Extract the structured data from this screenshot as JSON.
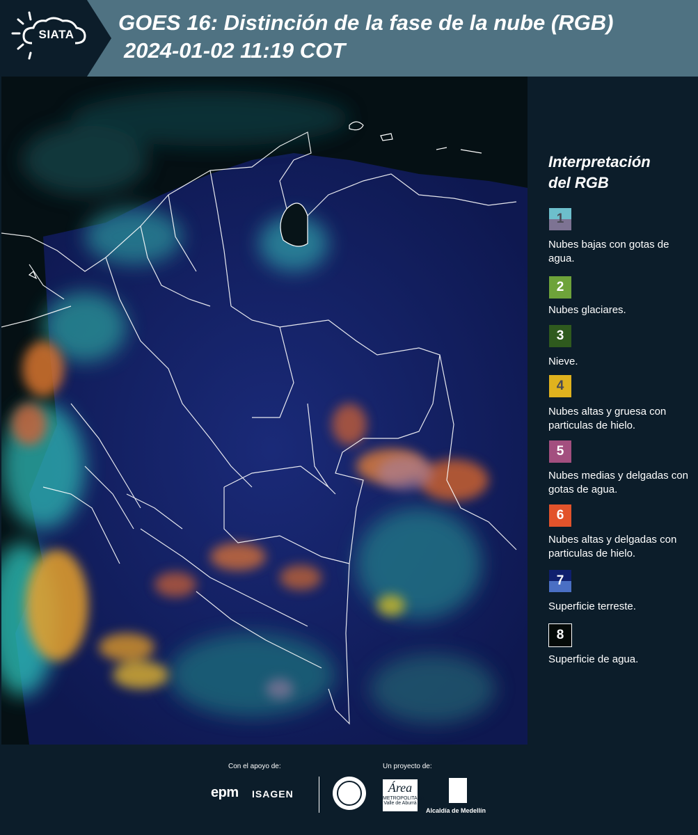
{
  "header": {
    "logo_text": "SIATA",
    "title": "GOES 16: Distinción de la fase de la nube (RGB)",
    "subtitle": "2024-01-02 11:19 COT"
  },
  "legend": {
    "title_line1": "Interpretación",
    "title_line2": "del RGB",
    "items": [
      {
        "num": "1",
        "label": "Nubes bajas con gotas de agua.",
        "color_top": "#6dbfcc",
        "color_bottom": "#7d7393",
        "num_color": "#4a4a55"
      },
      {
        "num": "2",
        "label": "Nubes glaciares.",
        "color_top": "#6ea33a",
        "color_bottom": "#6ea33a",
        "num_color": "#ffffff"
      },
      {
        "num": "3",
        "label": "Nieve.",
        "color_top": "#2f5a1e",
        "color_bottom": "#2f5a1e",
        "num_color": "#ffffff"
      },
      {
        "num": "4",
        "label": "Nubes altas y gruesa con particulas de hielo.",
        "color_top": "#e0b21e",
        "color_bottom": "#e0b21e",
        "num_color": "#4a4a55"
      },
      {
        "num": "5",
        "label": "Nubes medias y delgadas con gotas de agua.",
        "color_top": "#a34f7f",
        "color_bottom": "#a34f7f",
        "num_color": "#ffffff"
      },
      {
        "num": "6",
        "label": "Nubes altas y delgadas con particulas de hielo.",
        "color_top": "#e2532b",
        "color_bottom": "#e2532b",
        "num_color": "#ffffff"
      },
      {
        "num": "7",
        "label": "Superficie terreste.",
        "color_top": "#0f1f6e",
        "color_bottom": "#4a6fc4",
        "num_color": "#ffffff"
      },
      {
        "num": "8",
        "label": "Superficie de agua.",
        "color_top": "#050a08",
        "color_bottom": "#050a08",
        "num_color": "#ffffff"
      }
    ]
  },
  "footer": {
    "support_label": "Con el apoyo de:",
    "project_label": "Un proyecto de:",
    "epm": "epm",
    "isagen": "ISAGEN",
    "area_text": "METROPOLITANA Valle de Aburrá",
    "area_letter": "Área",
    "alcaldia": "Alcaldía de Medellín"
  }
}
